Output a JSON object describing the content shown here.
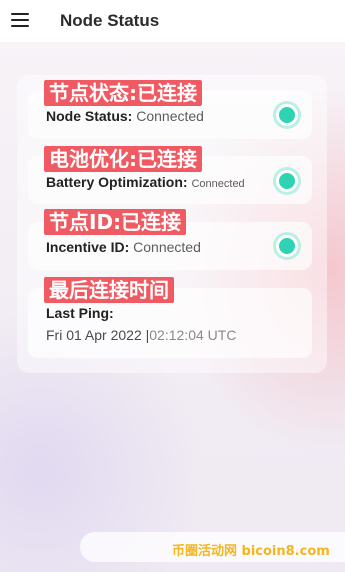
{
  "header": {
    "title": "Node Status"
  },
  "rows": [
    {
      "tag": "节点状态:已连接",
      "label": "Node Status:",
      "value": "Connected",
      "status_color": "#2ed3b4"
    },
    {
      "tag": "电池优化:已连接",
      "label": "Battery Optimization:",
      "value": "Connected",
      "status_color": "#2ed3b4"
    },
    {
      "tag": "节点ID:已连接",
      "label": "Incentive ID:",
      "value": "Connected",
      "status_color": "#2ed3b4"
    }
  ],
  "last_ping": {
    "tag": "最后连接时间",
    "label": "Last Ping:",
    "date": "Fri 01 Apr 2022",
    "separator": "|",
    "time": "02:12:04 UTC"
  },
  "watermark": {
    "text": "币圈活动网 bicoin8.com"
  },
  "colors": {
    "tag_bg": "#f05b63",
    "status": "#2ed3b4",
    "watermark": "#f3b521"
  }
}
